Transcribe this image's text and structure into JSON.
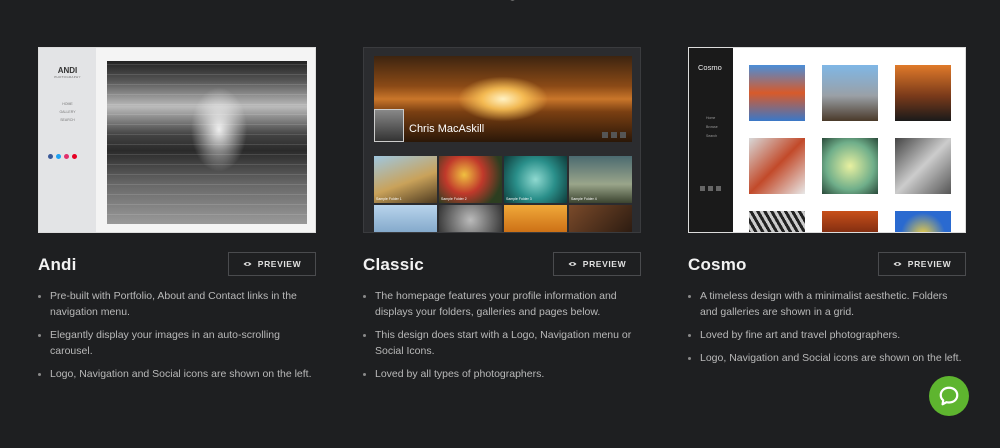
{
  "cards": [
    {
      "title": "Andi",
      "preview_label": "PREVIEW",
      "features": [
        "Pre-built with Portfolio, About and Contact links in the navigation menu.",
        "Elegantly display your images in an auto-scrolling carousel.",
        "Logo, Navigation and Social icons are shown on the left."
      ],
      "thumb": {
        "name": "ANDI",
        "sub": "PHOTOGRAPHY",
        "nav": [
          "HOME",
          "GALLERY",
          "SEARCH"
        ]
      }
    },
    {
      "title": "Classic",
      "preview_label": "PREVIEW",
      "features": [
        "The homepage features your profile information and displays your folders, galleries and pages below.",
        "This design does start with a Logo, Navigation menu or Social Icons.",
        "Loved by all types of photographers."
      ],
      "thumb": {
        "name": "Chris MacAskill",
        "captions": [
          "Sample Folder 1",
          "Sample Folder 2",
          "Sample Folder 3",
          "Sample Folder 4"
        ]
      }
    },
    {
      "title": "Cosmo",
      "preview_label": "PREVIEW",
      "features": [
        "A timeless design with a minimalist aesthetic. Folders and galleries are shown in a grid.",
        "Loved by fine art and travel photographers.",
        "Logo, Navigation and Social icons are shown on the left."
      ],
      "thumb": {
        "name": "Cosmo",
        "nav": [
          "Home",
          "Browse",
          "Search"
        ]
      }
    }
  ],
  "colors": {
    "background": "#1e1f21",
    "chat_button": "#5eb52f"
  },
  "icons": [
    "eye-icon",
    "chat-bubble-icon"
  ]
}
